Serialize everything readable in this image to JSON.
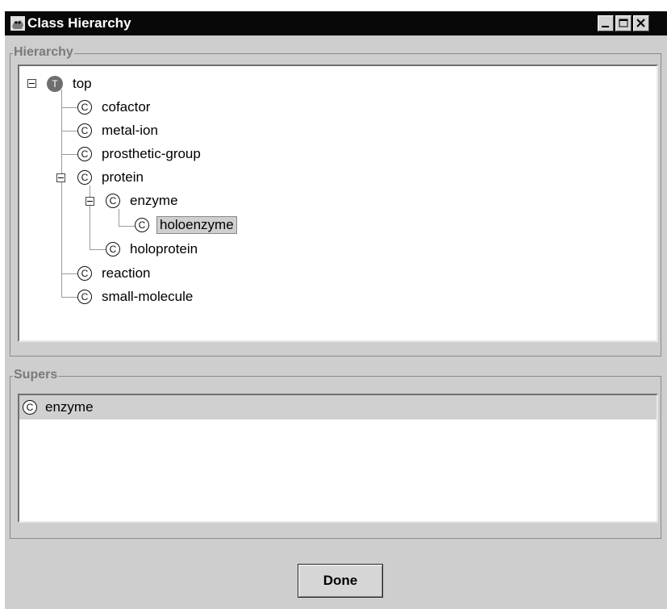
{
  "window": {
    "title": "Class Hierarchy"
  },
  "hierarchy": {
    "group_label": "Hierarchy",
    "root": {
      "label": "top",
      "badge": "T"
    },
    "class_badge": "C",
    "nodes": [
      {
        "label": "cofactor",
        "depth": 1
      },
      {
        "label": "metal-ion",
        "depth": 1
      },
      {
        "label": "prosthetic-group",
        "depth": 1
      },
      {
        "label": "protein",
        "depth": 1,
        "expanded": true
      },
      {
        "label": "enzyme",
        "depth": 2,
        "expanded": true
      },
      {
        "label": "holoenzyme",
        "depth": 3,
        "selected": true
      },
      {
        "label": "holoprotein",
        "depth": 2
      },
      {
        "label": "reaction",
        "depth": 1
      },
      {
        "label": "small-molecule",
        "depth": 1
      }
    ]
  },
  "supers": {
    "group_label": "Supers",
    "items": [
      {
        "label": "enzyme",
        "badge": "C",
        "selected": true
      }
    ]
  },
  "buttons": {
    "done_label": "Done"
  }
}
